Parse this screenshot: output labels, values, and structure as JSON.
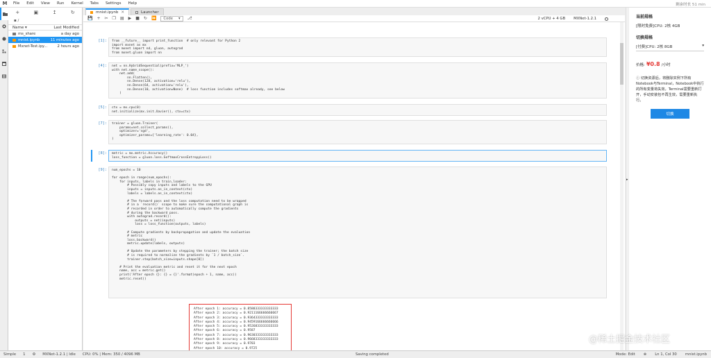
{
  "menubar": {
    "logo": "Ⅿ",
    "items": [
      "File",
      "Edit",
      "View",
      "Run",
      "Kernel",
      "Tabs",
      "Settings",
      "Help"
    ],
    "right_text": "剩余时长 51 min"
  },
  "iconbar": {
    "icons": [
      "folder-icon",
      "running-icon",
      "commands-icon",
      "palette-icon",
      "tabs-icon",
      "extension-icon"
    ]
  },
  "filebrowser": {
    "toolbar": [
      "+",
      "▣",
      "↥",
      "↻"
    ],
    "path": "▪ /",
    "header_name": "Name ▾",
    "header_modified": "Last Modified",
    "files": [
      {
        "name": "ms_share",
        "modified": "a day ago",
        "type": "folder"
      },
      {
        "name": "mnist.ipynb",
        "modified": "11 minutes ago",
        "type": "notebook"
      },
      {
        "name": "Mxnet-Test.ipy...",
        "modified": "2 hours ago",
        "type": "notebook"
      }
    ]
  },
  "tabs": [
    {
      "label": "mnist.ipynb",
      "active": true
    },
    {
      "label": "Launcher",
      "active": false
    }
  ],
  "nbtoolbar": {
    "buttons": [
      "💾",
      "+",
      "✂",
      "❐",
      "▤",
      "▶",
      "■",
      "↻",
      "⏩"
    ],
    "cell_type": "Code",
    "cell_type_arrow": "▾",
    "git_icon": "⎇",
    "resources": "2 vCPU + 4 GB",
    "kernel_name": "MXNet-1.2.1"
  },
  "cells": [
    {
      "prompt": "[1]:",
      "code": "from __future__ import print_function  # only relevant for Python 2\nimport mxnet as mx\nfrom mxnet import nd, gluon, autograd\nfrom mxnet.gluon import nn"
    },
    {
      "prompt": "[4]:",
      "code": "net = nn.HybridSequential(prefix='MLP_')\nwith net.name_scope():\n    net.add(\n        nn.Flatten(),\n        nn.Dense(128, activation='relu'),\n        nn.Dense(64, activation='relu'),\n        nn.Dense(10, activation=None)  # loss function includes softmax already, see below\n    )"
    },
    {
      "prompt": "[5]:",
      "code": "ctx = mx.cpu(0)\nnet.initialize(mx.init.Xavier(), ctx=ctx)"
    },
    {
      "prompt": "[7]:",
      "code": "trainer = gluon.Trainer(\n    params=net.collect_params(),\n    optimizer='sgd',\n    optimizer_params={'learning_rate': 0.04},\n)"
    },
    {
      "prompt": "[8]:",
      "code": "metric = mx.metric.Accuracy()\nloss_function = gluon.loss.SoftmaxCrossEntropyLoss()"
    },
    {
      "prompt": "[9]:",
      "code": "num_epochs = 10\n\nfor epoch in range(num_epochs):\n    for inputs, labels in train_loader:\n        # Possibly copy inputs and labels to the GPU\n        inputs = inputs.as_in_context(ctx)\n        labels = labels.as_in_context(ctx)\n\n        # The forward pass and the loss computation need to be wrapped\n        # in a `record()` scope to make sure the computational graph is\n        # recorded in order to automatically compute the gradients\n        # during the backward pass.\n        with autograd.record():\n            outputs = net(inputs)\n            loss = loss_function(outputs, labels)\n\n        # Compute gradients by backpropagation and update the evaluation\n        # metric\n        loss.backward()\n        metric.update(labels, outputs)\n\n        # Update the parameters by stepping the trainer; the batch size\n        # is required to normalize the gradients by `1 / batch_size`.\n        trainer.step(batch_size=inputs.shape[0])\n\n    # Print the evaluation metric and reset it for the next epoch\n    name, acc = metric.get()\n    print('After epoch {}: {} = {}'.format(epoch + 1, name, acc))\n    metric.reset()"
    }
  ],
  "output": "After epoch 1: accuracy = 0.8588333333333333\nAfter epoch 2: accuracy = 0.9211166666666667\nAfter epoch 3: accuracy = 0.9364333333333333\nAfter epoch 4: accuracy = 0.9459166666666666\nAfter epoch 5: accuracy = 0.9526833333333333\nAfter epoch 6: accuracy = 0.9587\nAfter epoch 7: accuracy = 0.9630333333333333\nAfter epoch 8: accuracy = 0.9668333333333333\nAfter epoch 9: accuracy = 0.9703\nAfter epoch 10: accuracy = 0.9725",
  "rightpanel": {
    "current_title": "当前规格",
    "current_value": "[限时免费]CPU: 2核 4GB",
    "switch_title": "切换规格",
    "switch_value": "[付费]CPU: 2核 8GB",
    "switch_arrow": "▾",
    "price_label": "价格:",
    "price_value": "¥0.8",
    "price_unit": "/小时",
    "note": "ⓘ 切换资源后，将删除实例下所有Notebook与Terminal，Notebook中执行的所有变量将失效，Terminal需要重新打开，手动安装包不再生效，需要重新执行。",
    "button_label": "切换"
  },
  "statusbar": {
    "items": [
      "Simple",
      "1",
      "⚙",
      "MXNet-1.2.1 | Idle",
      "CPU: 0% | Mem: 350 / 4096 MB"
    ],
    "center": "Saving completed",
    "right": [
      "Mode: Edit",
      "⊗",
      "Ln 1, Col 30",
      "mnist.ipynb"
    ]
  },
  "watermark": "@稀土掘金技术社区"
}
